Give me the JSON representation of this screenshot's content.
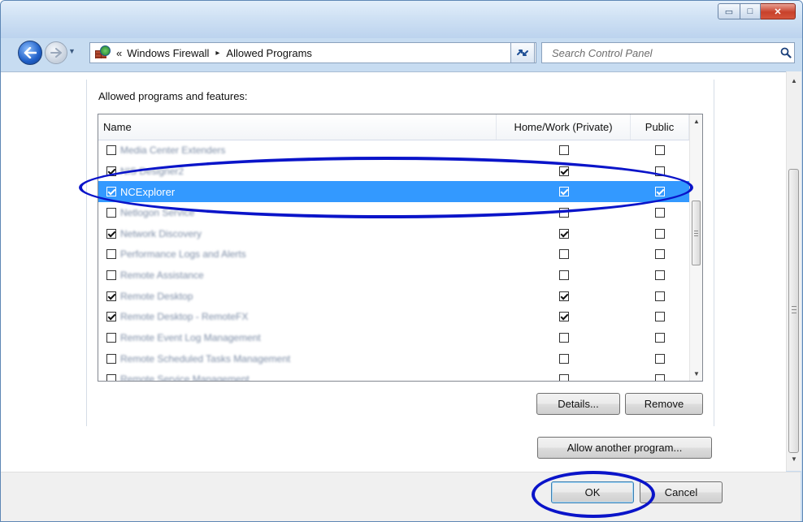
{
  "window": {
    "caption": {
      "minimize": "▭",
      "maximize": "□",
      "close": "✕"
    }
  },
  "nav": {
    "breadcrumb": {
      "overflow": "«",
      "items": [
        "Windows Firewall",
        "Allowed Programs"
      ],
      "separator": "▸"
    },
    "search_placeholder": "Search Control Panel",
    "icons": [
      "back-arrow-icon",
      "forward-arrow-icon",
      "recent-pages-icon",
      "control-panel-firewall-icon",
      "refresh-icon",
      "search-icon"
    ]
  },
  "panel": {
    "section_label": "Allowed programs and features:",
    "columns": {
      "name": "Name",
      "home": "Home/Work (Private)",
      "public": "Public"
    },
    "rows": [
      {
        "name": "Media Center Extenders",
        "enabled": false,
        "home": false,
        "public": false,
        "blurred": true,
        "selected": false
      },
      {
        "name": "NIS Designer2",
        "enabled": true,
        "home": true,
        "public": false,
        "blurred": true,
        "selected": false
      },
      {
        "name": "NCExplorer",
        "enabled": true,
        "home": true,
        "public": true,
        "blurred": false,
        "selected": true
      },
      {
        "name": "Netlogon Service",
        "enabled": false,
        "home": false,
        "public": false,
        "blurred": true,
        "selected": false
      },
      {
        "name": "Network Discovery",
        "enabled": true,
        "home": true,
        "public": false,
        "blurred": true,
        "selected": false
      },
      {
        "name": "Performance Logs and Alerts",
        "enabled": false,
        "home": false,
        "public": false,
        "blurred": true,
        "selected": false
      },
      {
        "name": "Remote Assistance",
        "enabled": false,
        "home": false,
        "public": false,
        "blurred": true,
        "selected": false
      },
      {
        "name": "Remote Desktop",
        "enabled": true,
        "home": true,
        "public": false,
        "blurred": true,
        "selected": false
      },
      {
        "name": "Remote Desktop - RemoteFX",
        "enabled": true,
        "home": true,
        "public": false,
        "blurred": true,
        "selected": false
      },
      {
        "name": "Remote Event Log Management",
        "enabled": false,
        "home": false,
        "public": false,
        "blurred": true,
        "selected": false
      },
      {
        "name": "Remote Scheduled Tasks Management",
        "enabled": false,
        "home": false,
        "public": false,
        "blurred": true,
        "selected": false
      },
      {
        "name": "Remote Service Management",
        "enabled": false,
        "home": false,
        "public": false,
        "blurred": true,
        "selected": false
      }
    ],
    "buttons": {
      "details": "Details...",
      "remove": "Remove",
      "allow_another": "Allow another program..."
    }
  },
  "footer": {
    "ok": "OK",
    "cancel": "Cancel"
  },
  "colors": {
    "selection": "#3399ff",
    "annotation": "#0a14c9",
    "titlebar": "#c7dcf1"
  }
}
